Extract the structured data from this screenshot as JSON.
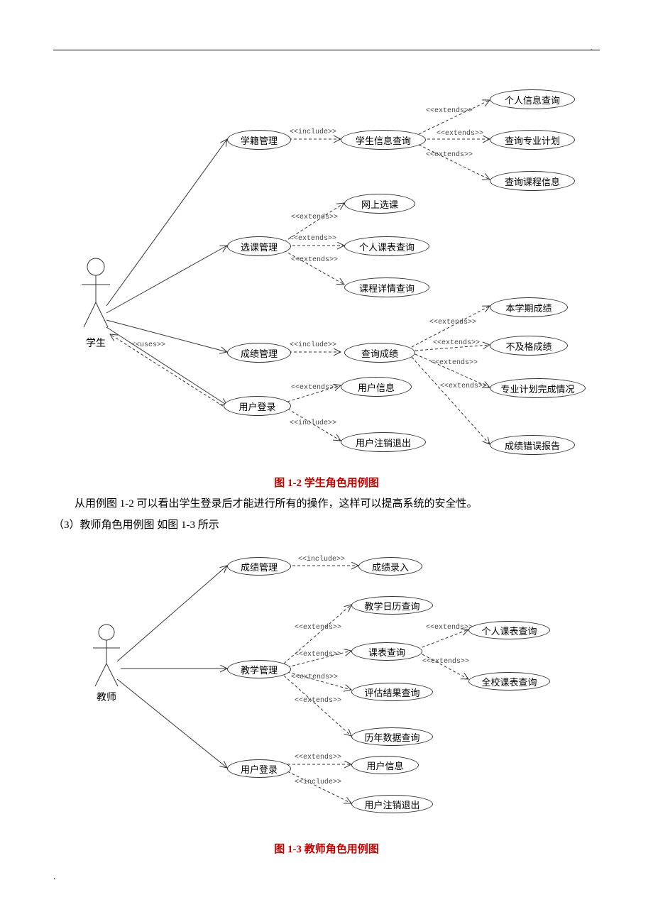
{
  "page": {
    "top_dot": ".",
    "bottom_dot": "."
  },
  "relations": {
    "include": "<<include>>",
    "extends": "<<extends>>",
    "uses": "<<uses>>"
  },
  "diagram1": {
    "actor": "学生",
    "usecases": {
      "academic_mgmt": "学籍管理",
      "student_info_query": "学生信息查询",
      "personal_info_query": "个人信息查询",
      "plan_query": "查询专业计划",
      "course_info_query": "查询课程信息",
      "course_select_mgmt": "选课管理",
      "online_select": "网上选课",
      "personal_schedule": "个人课表查询",
      "course_detail": "课程详情查询",
      "grade_mgmt": "成绩管理",
      "grade_query": "查询成绩",
      "term_grade": "本学期成绩",
      "fail_grade": "不及格成绩",
      "plan_complete": "专业计划完成情况",
      "grade_error": "成绩错误报告",
      "user_login": "用户登录",
      "user_info": "用户信息",
      "user_logout": "用户注销退出"
    }
  },
  "caption1": "图 1-2 学生角色用例图",
  "para1": "从用例图 1-2 可以看出学生登录后才能进行所有的操作，这样可以提高系统的安全性。",
  "para2": "（3）教师角色用例图  如图 1-3 所示",
  "diagram2": {
    "actor": "教师",
    "usecases": {
      "grade_mgmt": "成绩管理",
      "grade_entry": "成绩录入",
      "teach_mgmt": "教学管理",
      "calendar_query": "教学日历查询",
      "schedule_query": "课表查询",
      "personal_schedule": "个人课表查询",
      "school_schedule": "全校课表查询",
      "eval_query": "评估结果查询",
      "history_query": "历年数据查询",
      "user_login": "用户登录",
      "user_info": "用户信息",
      "user_logout": "用户注销退出"
    }
  },
  "caption2": "图 1-3 教师角色用例图"
}
